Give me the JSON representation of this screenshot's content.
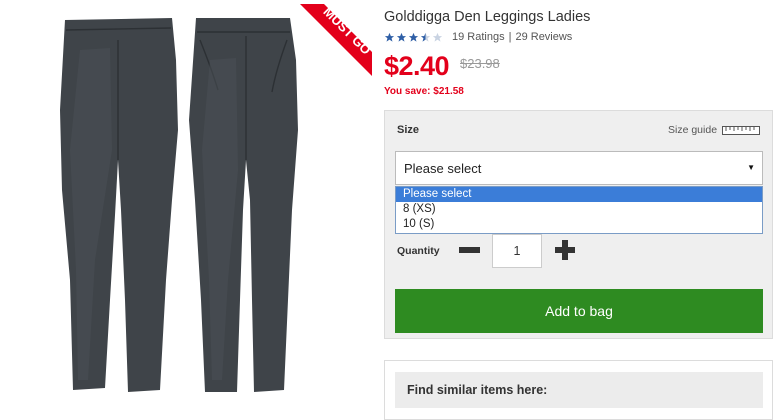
{
  "product": {
    "badge_text": "MUST GO",
    "title": "Golddigga Den Leggings Ladies",
    "ratings": "19 Ratings",
    "reviews": "29 Reviews",
    "ratings_separator": "|",
    "star_rating": 3.5,
    "price": "$2.40",
    "was_price": "$23.98",
    "you_save": "You save: $21.58"
  },
  "options": {
    "size_label": "Size",
    "size_guide_label": "Size guide",
    "select_value": "Please select",
    "dropdown_options": [
      "Please select",
      "8 (XS)",
      "10 (S)"
    ],
    "selected_index": 0,
    "quantity_label": "Quantity",
    "quantity_value": "1",
    "add_button": "Add to bag"
  },
  "similar": {
    "heading": "Find similar items here:"
  },
  "colors": {
    "price_red": "#e3001b",
    "button_green": "#2e8b21",
    "star_blue": "#2f5fa6",
    "highlight_blue": "#3b7dd8"
  }
}
